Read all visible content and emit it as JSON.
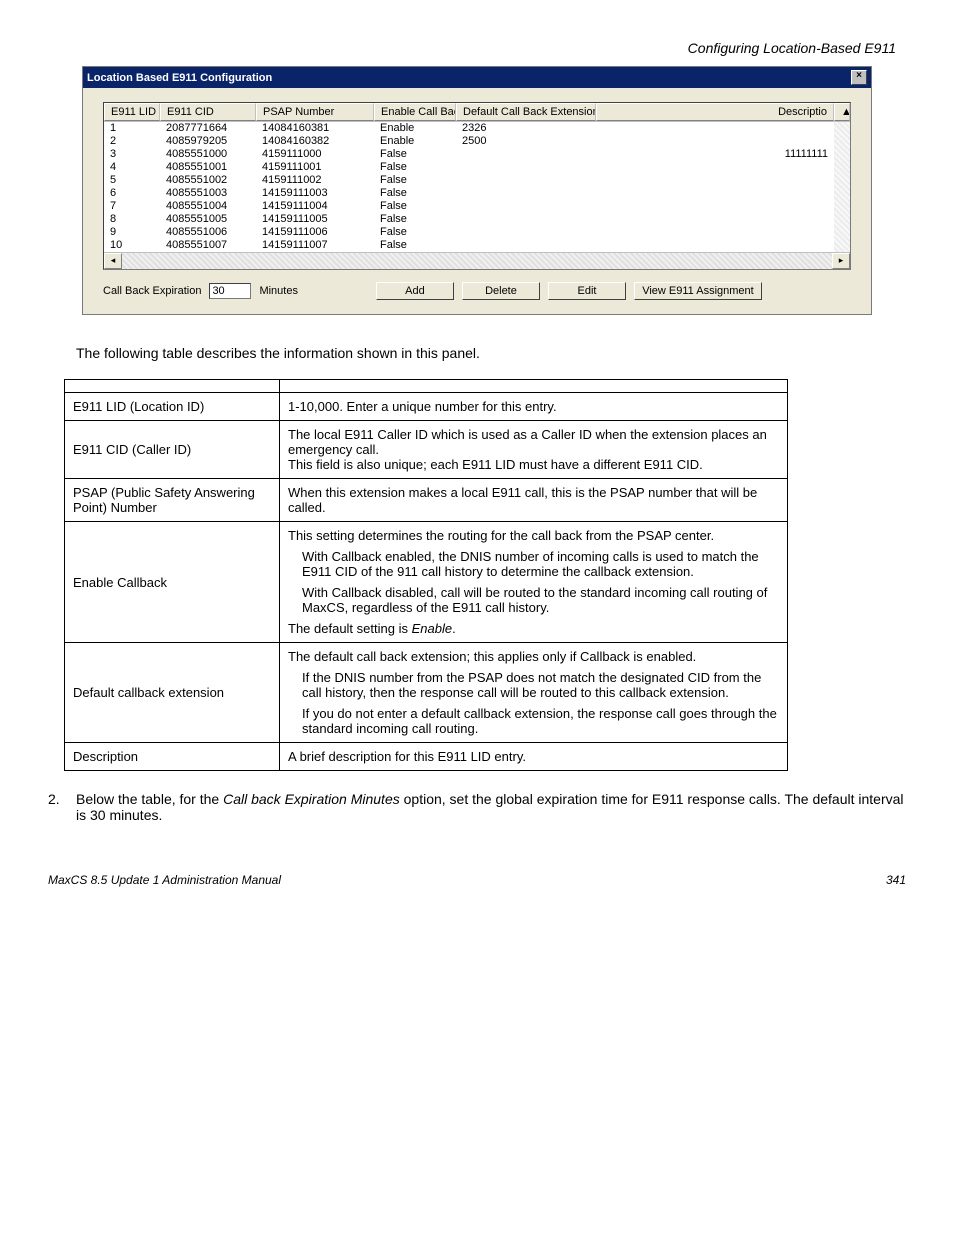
{
  "headerRight": "Configuring Location-Based E911",
  "dialog": {
    "title": "Location Based E911 Configuration",
    "columns": [
      "E911 LID",
      "E911 CID",
      "PSAP Number",
      "Enable Call Back",
      "Default Call Back Extension",
      "Descriptio"
    ],
    "rows": [
      {
        "lid": "1",
        "cid": "2087771664",
        "psap": "14084160381",
        "ecb": "Enable",
        "dcbe": "2326",
        "desc": ""
      },
      {
        "lid": "2",
        "cid": "4085979205",
        "psap": "14084160382",
        "ecb": "Enable",
        "dcbe": "2500",
        "desc": ""
      },
      {
        "lid": "3",
        "cid": "4085551000",
        "psap": "4159111000",
        "ecb": "False",
        "dcbe": "",
        "desc": "11111111"
      },
      {
        "lid": "4",
        "cid": "4085551001",
        "psap": "4159111001",
        "ecb": "False",
        "dcbe": "",
        "desc": ""
      },
      {
        "lid": "5",
        "cid": "4085551002",
        "psap": "4159111002",
        "ecb": "False",
        "dcbe": "",
        "desc": ""
      },
      {
        "lid": "6",
        "cid": "4085551003",
        "psap": "14159111003",
        "ecb": "False",
        "dcbe": "",
        "desc": ""
      },
      {
        "lid": "7",
        "cid": "4085551004",
        "psap": "14159111004",
        "ecb": "False",
        "dcbe": "",
        "desc": ""
      },
      {
        "lid": "8",
        "cid": "4085551005",
        "psap": "14159111005",
        "ecb": "False",
        "dcbe": "",
        "desc": ""
      },
      {
        "lid": "9",
        "cid": "4085551006",
        "psap": "14159111006",
        "ecb": "False",
        "dcbe": "",
        "desc": ""
      },
      {
        "lid": "10",
        "cid": "4085551007",
        "psap": "14159111007",
        "ecb": "False",
        "dcbe": "",
        "desc": ""
      }
    ],
    "callbackExpLabel": "Call Back Expiration",
    "callbackExpValue": "30",
    "minutesLabel": "Minutes",
    "buttons": {
      "add": "Add",
      "delete": "Delete",
      "edit": "Edit",
      "view": "View E911 Assignment"
    }
  },
  "narr1": "The following table describes the information shown in this panel.",
  "descTable": {
    "r1": {
      "label": "E911 LID (Location ID)",
      "text": "1-10,000. Enter a unique number for this entry."
    },
    "r2": {
      "label": "E911 CID (Caller ID)",
      "l1": "The local E911 Caller ID which is used as a Caller ID when the extension places an emergency call.",
      "l2": "This field is also unique; each E911 LID must have a different E911 CID."
    },
    "r3": {
      "label": "PSAP (Public Safety Answering Point) Number",
      "text": "When this extension makes a local E911 call, this is the PSAP number that will be called."
    },
    "r4": {
      "label": "Enable Callback",
      "p1": "This setting determines the routing for the call back from the PSAP center.",
      "s1": "With Callback enabled, the DNIS number of incoming calls is used to match the E911 CID of the 911 call history to determine the callback extension.",
      "s2": "With Callback disabled, call will be routed to the standard incoming call routing of MaxCS, regardless of the E911 call history.",
      "p2a": "The default setting is ",
      "p2b": "Enable",
      "p2c": "."
    },
    "r5": {
      "label": "Default callback extension",
      "p1": "The default call back extension; this applies only if Callback is enabled.",
      "s1": "If the DNIS number from the PSAP does not match the designated CID from the call history, then the response call will be routed to this callback extension.",
      "s2": "If you do not enter a default callback extension, the response call goes through the standard incoming call routing."
    },
    "r6": {
      "label": "Description",
      "text": "A brief description for this E911 LID entry."
    }
  },
  "step2": {
    "num": "2.",
    "t1": "Below the table, for the ",
    "emph": "Call back Expiration Minutes",
    "t2": " option, set the global expiration time for E911 response calls. The default interval is 30 minutes."
  },
  "footer": {
    "left": "MaxCS 8.5 Update 1 Administration Manual",
    "right": "341"
  }
}
